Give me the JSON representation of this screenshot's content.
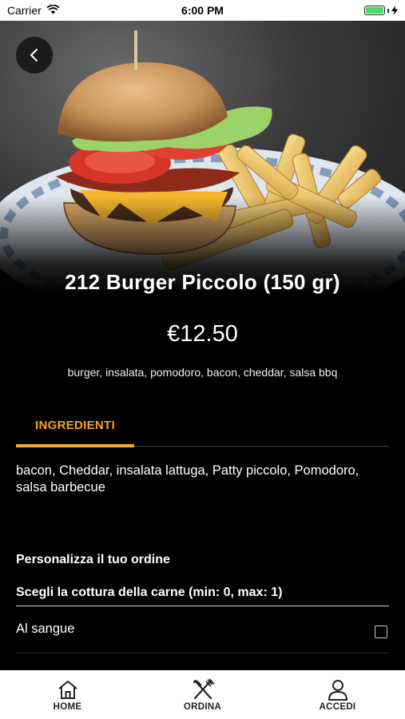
{
  "status_bar": {
    "carrier": "Carrier",
    "time": "6:00 PM"
  },
  "product": {
    "title": "212 Burger Piccolo (150 gr)",
    "price": "€12.50",
    "description": "burger, insalata, pomodoro, bacon, cheddar, salsa bbq"
  },
  "tabs": [
    {
      "label": "INGREDIENTI",
      "active": true
    }
  ],
  "ingredients_text": "bacon, Cheddar, insalata lattuga, Patty piccolo, Pomodoro, salsa barbecue",
  "customize": {
    "title": "Personalizza il tuo ordine",
    "group_title": "Scegli la cottura della carne  (min: 0, max: 1)",
    "options": [
      {
        "label": "Al sangue",
        "checked": false
      }
    ]
  },
  "bottom_nav": [
    {
      "label": "HOME",
      "icon": "home-icon"
    },
    {
      "label": "ORDINA",
      "icon": "fork-knife-icon"
    },
    {
      "label": "ACCEDI",
      "icon": "user-icon"
    }
  ],
  "colors": {
    "accent": "#f5a623",
    "background": "#000000",
    "battery": "#4cd964"
  }
}
